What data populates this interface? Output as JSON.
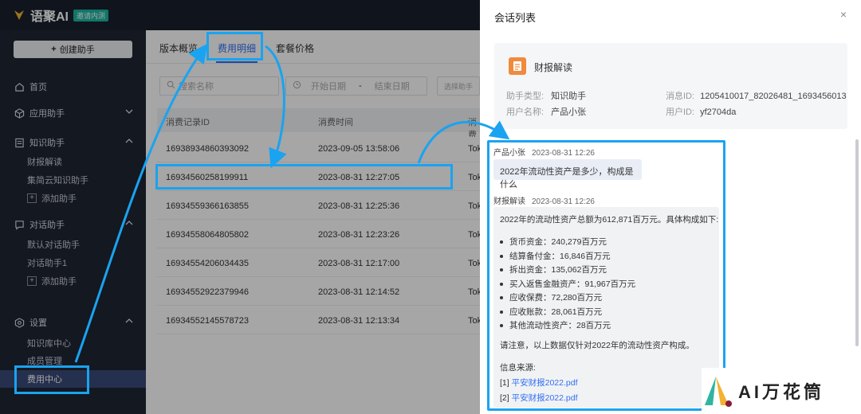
{
  "brand": {
    "name": "语聚AI",
    "tag": "邀请内测"
  },
  "sidebar": {
    "create_button": "创建助手",
    "home": "首页",
    "apps": "应用助手",
    "knowledge": "知识助手",
    "knowledge_items": [
      "财报解读",
      "集简云知识助手"
    ],
    "add_assistant": "添加助手",
    "dialog": "对话助手",
    "dialog_items": [
      "默认对话助手",
      "对话助手1"
    ],
    "settings": "设置",
    "settings_items": [
      "知识库中心",
      "成员管理",
      "费用中心"
    ]
  },
  "tabs": [
    "版本概览",
    "费用明细",
    "套餐价格"
  ],
  "filters": {
    "search_placeholder": "搜索名称",
    "start_date": "开始日期",
    "date_sep": "-",
    "end_date": "结束日期",
    "select_assistant": "选择助手"
  },
  "table": {
    "columns": [
      "消费记录ID",
      "消费时间",
      "消费"
    ],
    "rows": [
      {
        "id": "16938934860393092",
        "time": "2023-09-05 13:58:06",
        "cut": "Tok"
      },
      {
        "id": "16934560258199911",
        "time": "2023-08-31 12:27:05",
        "cut": "Tok"
      },
      {
        "id": "16934559366163855",
        "time": "2023-08-31 12:25:36",
        "cut": "Tok"
      },
      {
        "id": "16934558064805802",
        "time": "2023-08-31 12:23:26",
        "cut": "Tok"
      },
      {
        "id": "16934554206034435",
        "time": "2023-08-31 12:17:00",
        "cut": "Tok"
      },
      {
        "id": "16934552922379946",
        "time": "2023-08-31 12:14:52",
        "cut": "Tok"
      },
      {
        "id": "16934552145578723",
        "time": "2023-08-31 12:13:34",
        "cut": "Tok"
      }
    ]
  },
  "drawer": {
    "title": "会话列表",
    "close": "×",
    "agent_name": "财报解读",
    "assistant_type_label": "助手类型:",
    "assistant_type": "知识助手",
    "message_id_label": "消息ID:",
    "message_id": "1205410017_82026481_1693456013",
    "user_name_label": "用户名称:",
    "user_name": "产品小张",
    "user_id_label": "用户ID:",
    "user_id": "yf2704da"
  },
  "chat": {
    "q_user": "产品小张",
    "q_time": "2023-08-31 12:26",
    "question": "2022年流动性资产是多少，构成是什么",
    "a_user": "财报解读",
    "a_time": "2023-08-31 12:26",
    "answer_intro": "2022年的流动性资产总额为612,871百万元。具体构成如下:",
    "items": [
      "货币资金：240,279百万元",
      "结算备付金：16,846百万元",
      "拆出资金：135,062百万元",
      "买入返售金融资产：91,967百万元",
      "应收保费：72,280百万元",
      "应收账款：28,061百万元",
      "其他流动性资产：28百万元"
    ],
    "note": "请注意，以上数据仅针对2022年的流动性资产构成。",
    "source_label": "信息来源:",
    "sources": [
      {
        "idx": "[1]",
        "name": "平安财报2022.pdf"
      },
      {
        "idx": "[2]",
        "name": "平安财报2022.pdf"
      }
    ]
  },
  "watermark": "AI万花筒",
  "colors": {
    "accent": "#2f6ff5",
    "highlight": "#1aa3f0",
    "sidebar_bg": "#1f2533"
  }
}
